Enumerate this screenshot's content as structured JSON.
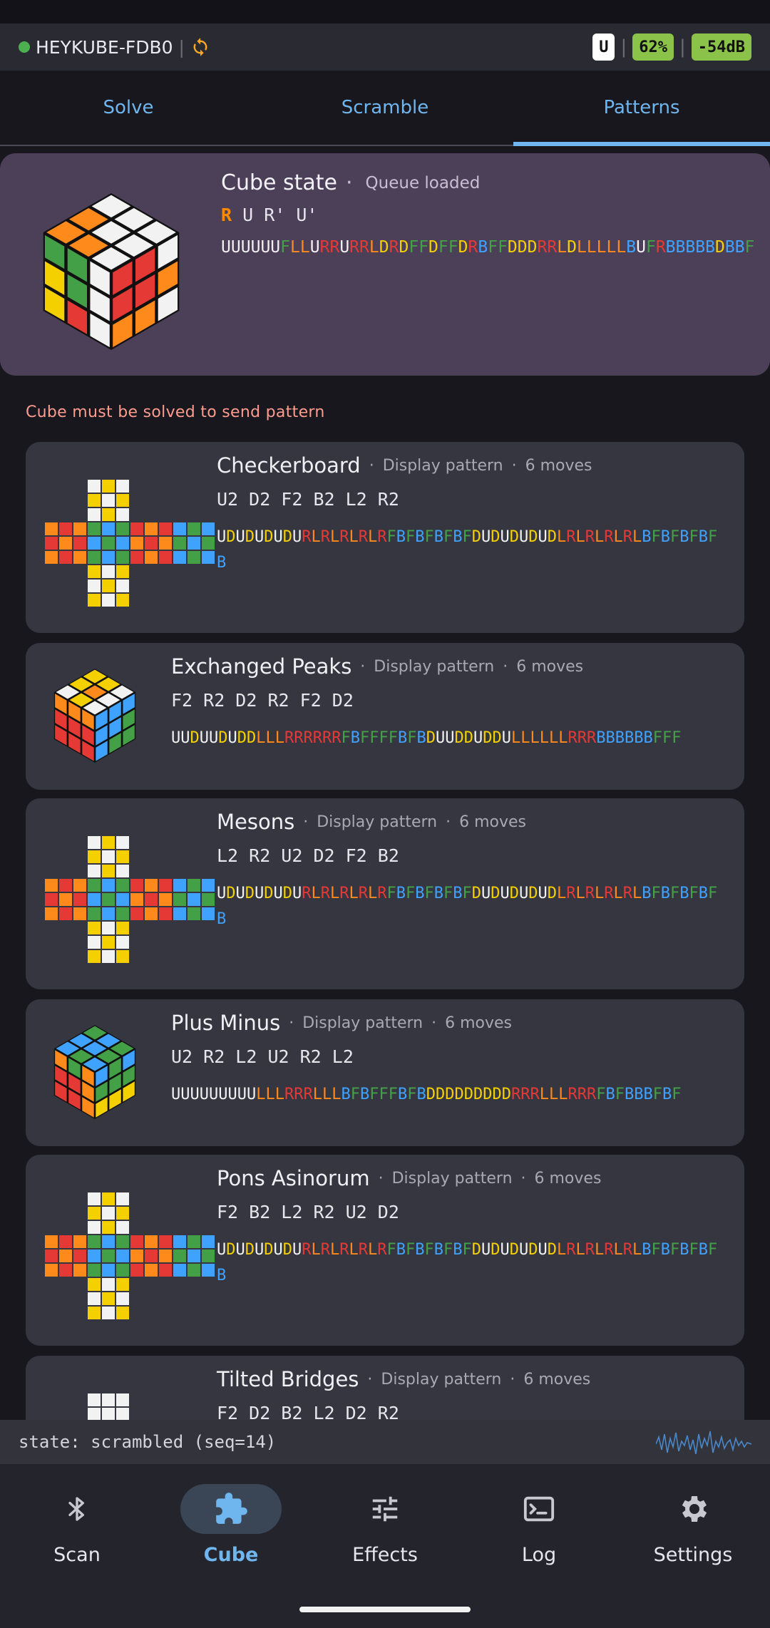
{
  "header": {
    "device_name": "HEYKUBE-FDB0",
    "separator": "|",
    "badge_u": "U",
    "battery": "62%",
    "signal": "-54dB",
    "connected_color": "#4caf50"
  },
  "tabs": [
    "Solve",
    "Scramble",
    "Patterns"
  ],
  "active_tab": "Patterns",
  "cube_state": {
    "title": "Cube state",
    "subtitle": "Queue loaded",
    "moves_first": "R",
    "moves_rest": " U R' U'",
    "facelets": "UUUUUUFLLURRURRLDRDFFDFFDRBFFDDDRRLDLLLLLBUFRBBBBBDBBF"
  },
  "warning": "Cube must be solved to send pattern",
  "patterns": [
    {
      "name": "Checkerboard",
      "type": "Display pattern",
      "moves_count": "6 moves",
      "moves": "U2 D2 F2 B2 L2 R2",
      "facelets": "UDUDUDUDURLRLRLRLRFBFBFBFBFDUDUDUDUDLRLRLRLRLBFBFBFBFB",
      "thumb": "net"
    },
    {
      "name": "Exchanged Peaks",
      "type": "Display pattern",
      "moves_count": "6 moves",
      "moves": "F2 R2 D2 R2 F2 D2",
      "facelets": "UUDUUDUDDLLLRRRRRRFBFFFFBFBDUUDDUDDULLLLLLRRRBBBBBBFFF",
      "thumb": "cube"
    },
    {
      "name": "Mesons",
      "type": "Display pattern",
      "moves_count": "6 moves",
      "moves": "L2 R2 U2 D2 F2 B2",
      "facelets": "UDUDUDUDURLRLRLRLRFBFBFBFBFDUDUDUDUDLRLRLRLRLBFBFBFBFB",
      "thumb": "net"
    },
    {
      "name": "Plus Minus",
      "type": "Display pattern",
      "moves_count": "6 moves",
      "moves": "U2 R2 L2 U2 R2 L2",
      "facelets": "UUUUUUUUULLLRRRLLLBFBFFFBFBDDDDDDDDDRRRLLLRRRFBFBBBFBF",
      "thumb": "cube2"
    },
    {
      "name": "Pons Asinorum",
      "type": "Display pattern",
      "moves_count": "6 moves",
      "moves": "F2 B2 L2 R2 U2 D2",
      "facelets": "UDUDUDUDURLRLRLRLRFBFBFBFBFDUDUDUDUDLRLRLRLRLBFBFBFBFB",
      "thumb": "net"
    },
    {
      "name": "Tilted Bridges",
      "type": "Display pattern",
      "moves_count": "6 moves",
      "moves": "F2 D2 B2 L2 D2 R2",
      "facelets": "",
      "thumb": "net"
    }
  ],
  "console": {
    "text": "state: scrambled (seq=14)"
  },
  "nav": [
    {
      "label": "Scan",
      "icon": "bluetooth-icon"
    },
    {
      "label": "Cube",
      "icon": "puzzle-icon"
    },
    {
      "label": "Effects",
      "icon": "tune-icon"
    },
    {
      "label": "Log",
      "icon": "terminal-icon"
    },
    {
      "label": "Settings",
      "icon": "gear-icon"
    }
  ],
  "active_nav": "Cube",
  "colors": {
    "U": "#f2f2f2",
    "D": "#f5d000",
    "L": "#ff8a1c",
    "R": "#e53935",
    "F": "#43a047",
    "B": "#3fa2ff",
    "accent": "#6fb5ee",
    "warning": "#ff9c8e",
    "card": "#363641",
    "state_card": "#4c3f58"
  }
}
